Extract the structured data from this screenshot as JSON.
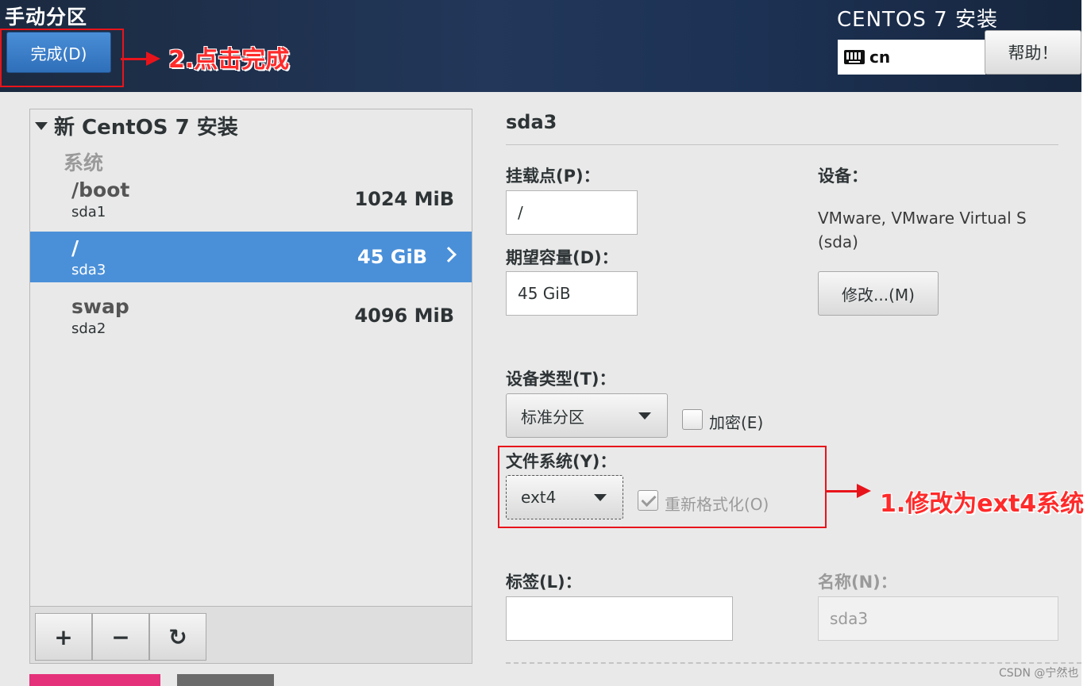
{
  "header": {
    "page_title": "手动分区",
    "done_label": "完成(D)",
    "installer_title": "CENTOS 7 安装",
    "keyboard_layout": "cn",
    "help_label": "帮助！"
  },
  "annotations": {
    "step2": "2.点击完成",
    "step1": "1.修改为ext4系统",
    "highlight_color": "#e8141b"
  },
  "left_panel": {
    "group_title": "新 CentOS 7 安装",
    "section_label": "系统",
    "partitions": [
      {
        "mount": "/boot",
        "device": "sda1",
        "size": "1024 MiB",
        "selected": false
      },
      {
        "mount": "/",
        "device": "sda3",
        "size": "45 GiB",
        "selected": true
      },
      {
        "mount": "swap",
        "device": "sda2",
        "size": "4096 MiB",
        "selected": false
      }
    ],
    "toolbar": {
      "add": "+",
      "remove": "−",
      "refresh": "↻"
    }
  },
  "details": {
    "title": "sda3",
    "mount_point_label": "挂载点(P)：",
    "mount_point_value": "/",
    "capacity_label": "期望容量(D)：",
    "capacity_value": "45 GiB",
    "device_label": "设备：",
    "device_line1": "VMware, VMware Virtual S",
    "device_line2": "(sda)",
    "modify_label": "修改...(M)",
    "device_type_label": "设备类型(T)：",
    "device_type_value": "标准分区",
    "encrypt_label": "加密(E)",
    "encrypt_checked": false,
    "filesystem_label": "文件系统(Y)：",
    "filesystem_value": "ext4",
    "reformat_label": "重新格式化(O)",
    "reformat_checked": true,
    "tag_label": "标签(L)：",
    "tag_value": "",
    "name_label": "名称(N)：",
    "name_value": "sda3"
  },
  "watermark": "CSDN @宁然也",
  "colors": {
    "selected_row": "#4a90d9",
    "header_bg": "#1c3153",
    "remove_strip": "#e5317a"
  }
}
